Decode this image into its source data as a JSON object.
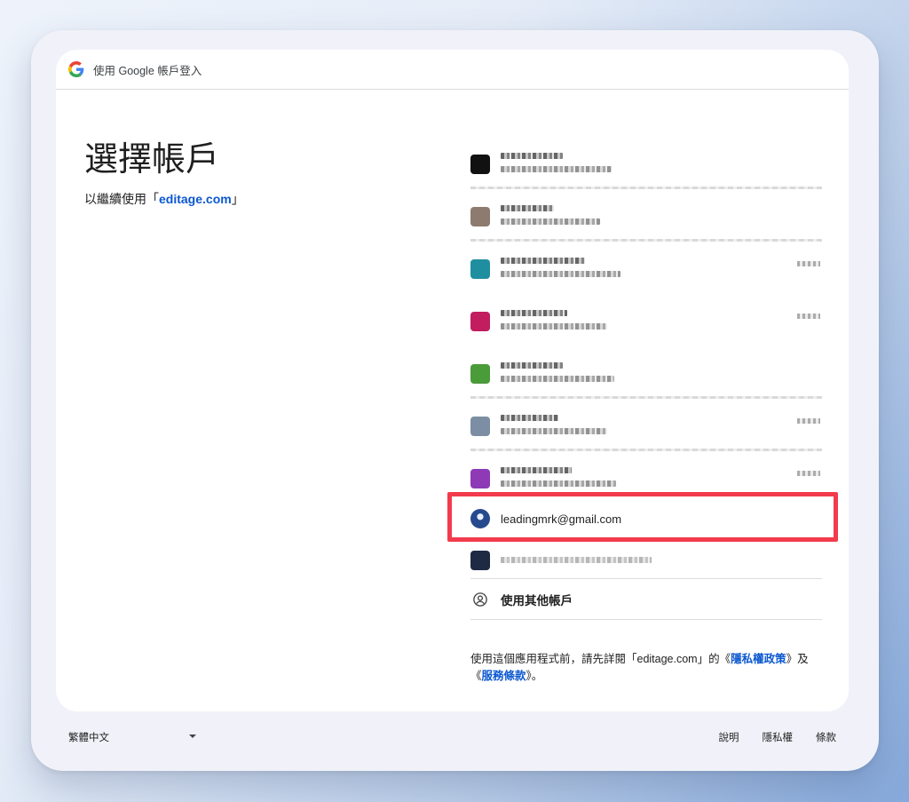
{
  "header": {
    "title": "使用 Google 帳戶登入",
    "logo_icon": "google-g-icon"
  },
  "main": {
    "title": "選擇帳戶",
    "subtitle_prefix": "以繼續使用「",
    "subtitle_link": "editage.com",
    "subtitle_suffix": "」"
  },
  "accounts": {
    "highlighted_email": "leadingmrk@gmail.com",
    "highlight_color": "#f23b4c",
    "use_other_label": "使用其他帳戶",
    "avatar_colors": [
      "#111111",
      "#8c7b6e",
      "#1f8fa0",
      "#c21d5e",
      "#4a9b3a",
      "#7b8ea3",
      "#8e39b6"
    ]
  },
  "consent": {
    "prefix": "使用這個應用程式前，請先詳閱「editage.com」的《",
    "privacy": "隱私權政策",
    "middle": "》及《",
    "terms": "服務條款",
    "suffix": "》。"
  },
  "footer": {
    "language": "繁體中文",
    "help": "說明",
    "privacy": "隱私權",
    "terms": "條款"
  },
  "colors": {
    "link": "#0b57d0",
    "text": "#1f1f1f"
  }
}
